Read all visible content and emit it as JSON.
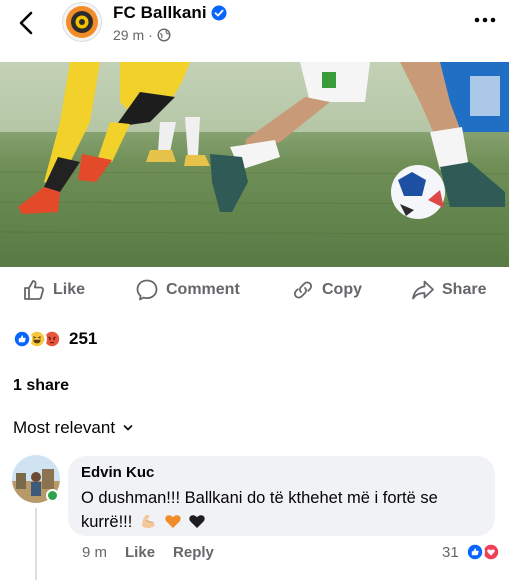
{
  "post": {
    "page_name": "FC Ballkani",
    "time": "29 m",
    "audience_icon": "globe-icon"
  },
  "actions": {
    "like": "Like",
    "comment": "Comment",
    "copy": "Copy",
    "share": "Share"
  },
  "reactions": {
    "types": [
      "like",
      "haha",
      "angry"
    ],
    "count": "251"
  },
  "shares_text": "1 share",
  "sort_label": "Most relevant",
  "comments": [
    {
      "author": "Edvin Kuc",
      "text": "O dushman!!! Ballkani do të kthehet më i fortë se kurrë!!!",
      "emojis": [
        "flexed-biceps",
        "orange-heart",
        "black-heart"
      ],
      "time": "9 m",
      "like_label": "Like",
      "reply_label": "Reply",
      "reaction_count": "31",
      "reaction_types": [
        "like",
        "love"
      ]
    }
  ],
  "colors": {
    "brand_blue": "#0866ff",
    "secondary_text": "#65676b",
    "bubble_bg": "#f0f2f5",
    "club_orange": "#f28c28"
  }
}
